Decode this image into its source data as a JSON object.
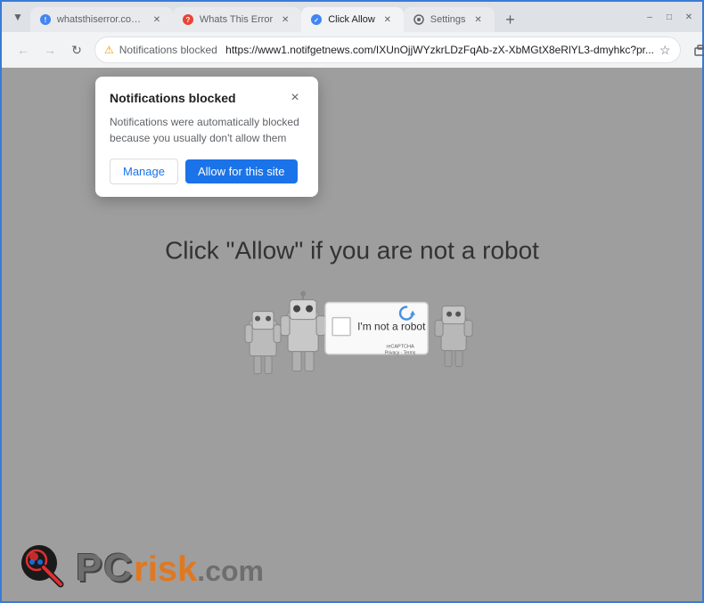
{
  "browser": {
    "tabs": [
      {
        "id": "tab1",
        "label": "whatsthiserror.com/b...",
        "favicon": "error",
        "active": false
      },
      {
        "id": "tab2",
        "label": "Whats This Error",
        "favicon": "error-red",
        "active": false
      },
      {
        "id": "tab3",
        "label": "Click Allow",
        "favicon": "blue-circle",
        "active": true
      },
      {
        "id": "tab4",
        "label": "Settings",
        "favicon": "gear",
        "active": false
      }
    ],
    "new_tab_icon": "+",
    "window_controls": [
      "─",
      "□",
      "✕"
    ],
    "address_bar": {
      "security_label": "Notifications blocked",
      "url": "https://www1.notifgetnews.com/IXUnOjjWYzkrLDzFqAb-zX-XbMGtX8eRlYL3-dmyhkc?pr...",
      "star_icon": "★"
    }
  },
  "notification_popup": {
    "title": "Notifications blocked",
    "close_label": "×",
    "message": "Notifications were automatically blocked because you usually don't allow them",
    "btn_manage": "Manage",
    "btn_allow": "Allow for this site"
  },
  "page": {
    "click_allow_text": "Click \"Allow\"  if you are not   a robot",
    "captcha": {
      "checkbox_label": "I'm not a robot",
      "recaptcha_label": "reCAPTCHA",
      "privacy": "Privacy",
      "terms": "Terms"
    }
  },
  "pcrisk": {
    "pc_text": "PC",
    "risk_text": "risk",
    "dotcom_text": ".com"
  }
}
